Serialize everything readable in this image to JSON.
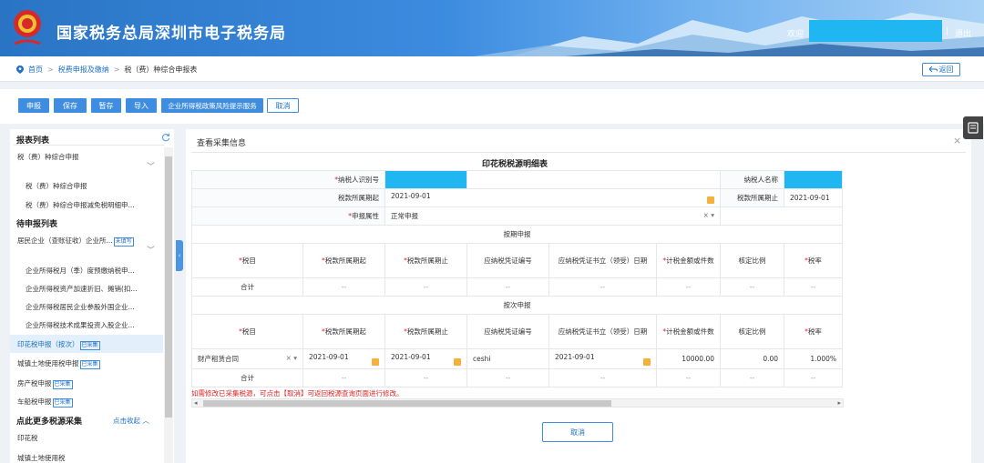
{
  "header": {
    "site_title": "国家税务总局深圳市电子税务局",
    "welcome": "欢迎",
    "separator": "|",
    "logout": "退出"
  },
  "breadcrumb": {
    "home": "首页",
    "level2": "税费申报及缴纳",
    "level3": "税（费）种综合申报表",
    "back": "返回"
  },
  "toolbar": {
    "buttons": [
      "申报",
      "保存",
      "暂存",
      "导入",
      "企业所得税政策风险提示服务",
      "取消"
    ]
  },
  "sidebar": {
    "report_list_title": "报表列表",
    "report_group": "税（费）种综合申报",
    "report_items": [
      "税（费）种综合申报",
      "税（费）种综合申报减免税明细申..."
    ],
    "pending_title": "待申报列表",
    "pending_group": "居民企业（查账征收）企业所...",
    "pending_group_badge": "未填写",
    "pending_items": [
      "企业所得税月（季）度预缴纳税申...",
      "企业所得税资产加速折旧、摊销(扣...",
      "企业所得税居民企业参股外国企业...",
      "企业所得税技术成果投资入股企业..."
    ],
    "collected": [
      {
        "label": "印花税申报（按次）",
        "badge": "已采集"
      },
      {
        "label": "城镇土地使用税申报",
        "badge": "已采集"
      },
      {
        "label": "房产税申报",
        "badge": "已采集"
      },
      {
        "label": "车船税申报",
        "badge": "已采集"
      }
    ],
    "more_title": "点此更多税源采集",
    "more_toggle": "点击收起",
    "more_items": [
      "印花税",
      "城镇土地使用税"
    ]
  },
  "panel": {
    "title": "查看采集信息",
    "form_title": "印花税税源明细表",
    "taxpayer_id_label": "纳税人识别号",
    "taxpayer_name_label": "纳税人名称",
    "period_start_label": "税款所属期起",
    "period_start": "2021-09-01",
    "period_end_label": "税款所属期止",
    "period_end": "2021-09-01",
    "attr_label": "申报属性",
    "attr_value": "正常申报",
    "periodic_section": "按期申报",
    "per_time_section": "按次申报",
    "columns": [
      "税目",
      "税款所属期起",
      "税款所属期止",
      "应纳税凭证编号",
      "应纳税凭证书立（领受）日期",
      "计税金额或件数",
      "核定比例",
      "税率"
    ],
    "total_label": "合计",
    "dash": "--",
    "row": {
      "item": "财产租赁合同",
      "start": "2021-09-01",
      "end": "2021-09-01",
      "voucher_no": "ceshi",
      "date": "2021-09-01",
      "amount": "10000.00",
      "ratio": "0.00",
      "rate": "1.000%"
    },
    "hint": "如需修改已采集税源，可点击【取消】可返回税源查询页面进行修改。",
    "cancel": "取消"
  },
  "colors": {
    "header_blue": "#2a74c4",
    "button_blue": "#3e8de0",
    "masked_cyan": "#20b6f2",
    "required_red": "#e02020"
  }
}
